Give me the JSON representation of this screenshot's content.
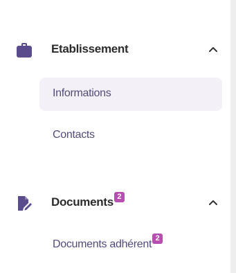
{
  "colors": {
    "accent": "#5a4b8c",
    "badge": "#b84fb0",
    "active_bg": "#f3f1f7",
    "text": "#534b7a"
  },
  "sections": [
    {
      "icon": "briefcase-icon",
      "label": "Etablissement",
      "expanded": true,
      "items": [
        {
          "label": "Informations",
          "active": true
        },
        {
          "label": "Contacts",
          "active": false
        }
      ]
    },
    {
      "icon": "document-edit-icon",
      "label": "Documents",
      "badge": "2",
      "expanded": true,
      "items": [
        {
          "label": "Documents adhérent",
          "badge": "2",
          "active": false
        }
      ]
    }
  ]
}
